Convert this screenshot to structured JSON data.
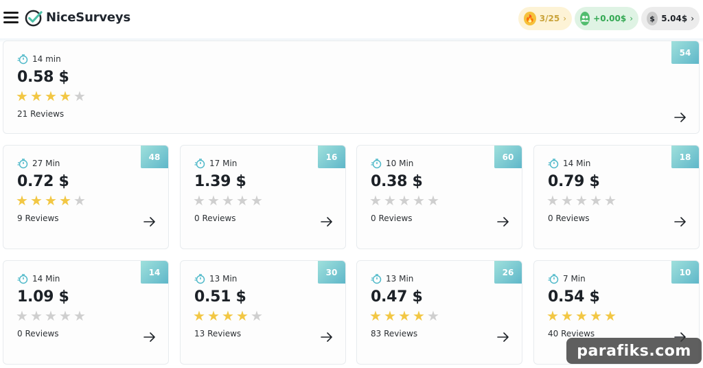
{
  "app": {
    "name": "NiceSurveys"
  },
  "header": {
    "streak": {
      "label": "3/25",
      "icon": "flame-icon"
    },
    "referral": {
      "label": "+0.00$",
      "icon": "users-icon"
    },
    "balance": {
      "label": "5.04$",
      "icon_text": "$"
    }
  },
  "featured": {
    "badge": "54",
    "duration": "14 min",
    "price": "0.58 $",
    "rating": 4,
    "reviews": "21 Reviews"
  },
  "surveys": [
    {
      "badge": "48",
      "duration": "27 Min",
      "price": "0.72 $",
      "rating": 4,
      "reviews": "9 Reviews"
    },
    {
      "badge": "16",
      "duration": "17 Min",
      "price": "1.39 $",
      "rating": 0,
      "reviews": "0 Reviews"
    },
    {
      "badge": "60",
      "duration": "10 Min",
      "price": "0.38 $",
      "rating": 0,
      "reviews": "0 Reviews"
    },
    {
      "badge": "18",
      "duration": "14 Min",
      "price": "0.79 $",
      "rating": 0,
      "reviews": "0 Reviews"
    },
    {
      "badge": "14",
      "duration": "14 Min",
      "price": "1.09 $",
      "rating": 0,
      "reviews": "0 Reviews"
    },
    {
      "badge": "30",
      "duration": "13 Min",
      "price": "0.51 $",
      "rating": 4,
      "reviews": "13 Reviews"
    },
    {
      "badge": "26",
      "duration": "13 Min",
      "price": "0.47 $",
      "rating": 4,
      "reviews": "83 Reviews"
    },
    {
      "badge": "10",
      "duration": "7 Min",
      "price": "0.54 $",
      "rating": 5,
      "reviews": "40 Reviews"
    }
  ],
  "watermark": "parafiks.com",
  "colors": {
    "star_on": "#f2c744",
    "star_off": "#cfcfcf",
    "badge_start": "#9fe0dc",
    "badge_end": "#5fb7c9"
  }
}
